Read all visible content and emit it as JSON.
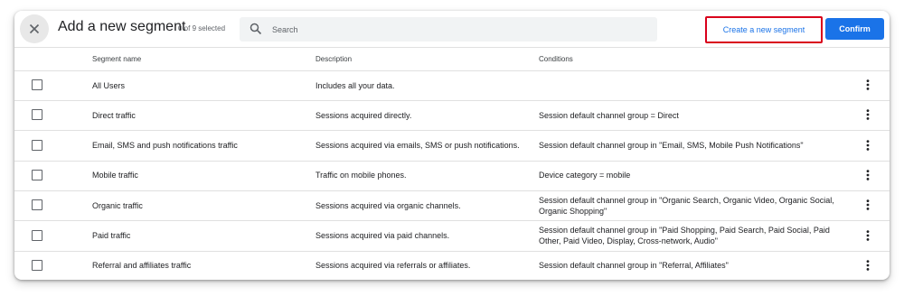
{
  "header": {
    "title": "Add a new segment",
    "selected_count": "0 of 9 selected",
    "search_placeholder": "Search",
    "create_label": "Create a new segment",
    "confirm_label": "Confirm"
  },
  "colors": {
    "accent": "#1a73e8",
    "highlight_border": "#d9001b"
  },
  "icons": {
    "close": "close-icon",
    "search": "search-icon",
    "more": "more-vert-icon"
  },
  "table": {
    "columns": [
      "Segment name",
      "Description",
      "Conditions"
    ],
    "rows": [
      {
        "name": "All Users",
        "description": "Includes all your data.",
        "conditions": ""
      },
      {
        "name": "Direct traffic",
        "description": "Sessions acquired directly.",
        "conditions": "Session default channel group = Direct"
      },
      {
        "name": "Email, SMS and push notifications traffic",
        "description": "Sessions acquired via emails, SMS or push notifications.",
        "conditions": "Session default channel group in \"Email, SMS, Mobile Push Notifications\""
      },
      {
        "name": "Mobile traffic",
        "description": "Traffic on mobile phones.",
        "conditions": "Device category = mobile"
      },
      {
        "name": "Organic traffic",
        "description": "Sessions acquired via organic channels.",
        "conditions": "Session default channel group in \"Organic Search, Organic Video, Organic Social, Organic Shopping\""
      },
      {
        "name": "Paid traffic",
        "description": "Sessions acquired via paid channels.",
        "conditions": "Session default channel group in \"Paid Shopping, Paid Search, Paid Social, Paid Other, Paid Video, Display, Cross-network, Audio\""
      },
      {
        "name": "Referral and affiliates traffic",
        "description": "Sessions acquired via referrals or affiliates.",
        "conditions": "Session default channel group in \"Referral, Affiliates\""
      }
    ]
  }
}
